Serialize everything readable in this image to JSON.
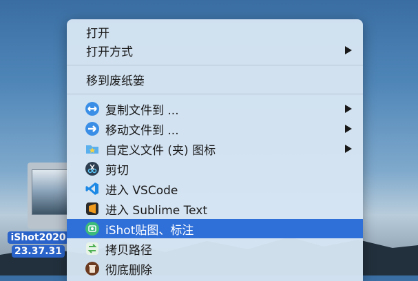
{
  "desktop": {
    "file_label_line1": "iShot2020",
    "file_label_line2": "23.37.31"
  },
  "menu": {
    "open": "打开",
    "open_with": "打开方式",
    "move_to_trash": "移到废纸篓",
    "copy_files_to": "复制文件到 ...",
    "move_files_to": "移动文件到 ...",
    "custom_folder_icon": "自定义文件 (夹) 图标",
    "cut": "剪切",
    "open_vscode": "进入 VSCode",
    "open_sublime": "进入 Sublime Text",
    "ishot": "iShot贴图、标注",
    "copy_path": "拷贝路径",
    "delete_permanently": "彻底删除"
  },
  "colors": {
    "menu_bg": "#d6e5f2",
    "highlight": "#2f6fd8",
    "selection_label": "#2a63c9"
  },
  "icons": [
    "copy-arrows-icon",
    "move-arrow-icon",
    "folder-star-icon",
    "scissors-icon",
    "vscode-icon",
    "sublime-icon",
    "ishot-icon",
    "copy-path-icon",
    "trash-icon"
  ]
}
